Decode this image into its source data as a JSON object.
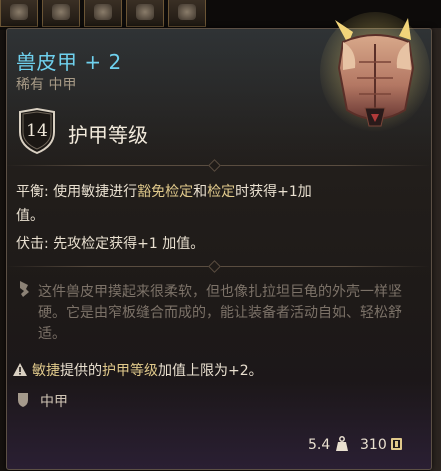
{
  "item": {
    "name": "兽皮甲 + 2",
    "subtitle": "稀有 中甲",
    "name_color": "#6fd1ee"
  },
  "armor_class": {
    "value": "14",
    "label": "护甲等级"
  },
  "passives": [
    {
      "name": "平衡:",
      "prefix": "使用敏捷进行",
      "hl1": "豁免检定",
      "mid": "和",
      "hl2": "检定",
      "suffix": "时获得+1加",
      "line2": "值。"
    },
    {
      "name": "伏击:",
      "text": "先攻检定获得+1 加值。"
    }
  ],
  "flavor": {
    "icon": "quill-icon",
    "text": "这件兽皮甲摸起来很柔软，但也像扎拉坦巨龟的外壳一样坚硬。它是由窄板缝合而成的，能让装备者活动自如、轻松舒适。"
  },
  "note": {
    "icon": "warning-icon",
    "hl1": "敏捷",
    "t1": "提供的",
    "hl2": "护甲等级",
    "t2": "加值上限为+2。"
  },
  "armor_type": {
    "icon": "shield-icon",
    "label": "中甲"
  },
  "footer": {
    "weight": "5.4",
    "weight_icon": "weight-icon",
    "price": "310",
    "price_icon": "coin-icon"
  },
  "colors": {
    "accent": "#6fd1ee",
    "highlight": "#e0c98b",
    "muted": "#7c7268"
  }
}
